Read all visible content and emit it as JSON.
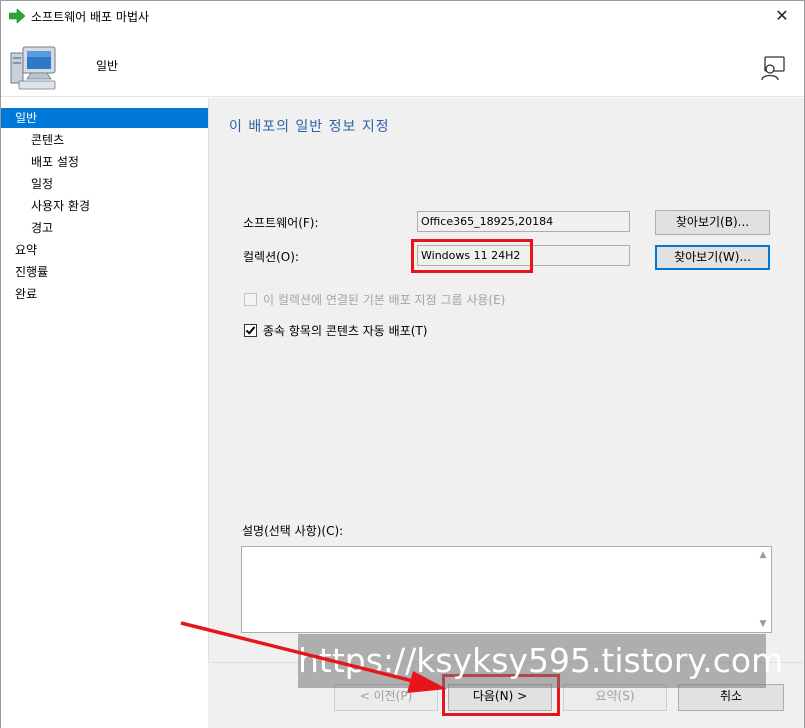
{
  "window": {
    "title": "소프트웨어 배포 마법사",
    "close_glyph": "✕"
  },
  "header": {
    "title": "일반"
  },
  "nav": {
    "items": [
      {
        "label": "일반",
        "active": true
      },
      {
        "label": "콘텐츠"
      },
      {
        "label": "배포 설정"
      },
      {
        "label": "일정"
      },
      {
        "label": "사용자 환경"
      },
      {
        "label": "경고"
      },
      {
        "label": "요약"
      },
      {
        "label": "진행률"
      },
      {
        "label": "완료"
      }
    ]
  },
  "main": {
    "heading": "이 배포의 일반 정보 지정",
    "software_label": "소프트웨어(F):",
    "software_value": "Office365_18925,20184",
    "software_browse": "찾아보기(B)...",
    "collection_label": "컬렉션(O):",
    "collection_value": "Windows 11 24H2",
    "collection_browse": "찾아보기(W)...",
    "use_default_dp_label": "이 컬렉션에 연결된 기본 배포 지점 그룹 사용(E)",
    "auto_distribute_label": "종속 항목의 콘텐츠 자동 배포(T)",
    "comment_label": "설명(선택 사항)(C):",
    "comment_value": ""
  },
  "footer": {
    "prev": "< 이전(P)",
    "next": "다음(N) >",
    "summary": "요약(S)",
    "cancel": "취소"
  },
  "overlay": {
    "watermark": "https://ksyksy595.tistory.com"
  },
  "colors": {
    "accent": "#0078d7",
    "heading": "#2e62a8",
    "highlight": "#e8141c"
  },
  "icons": {
    "title": "green-arrow-icon",
    "header": "computer-icon",
    "help": "help-person-icon"
  }
}
